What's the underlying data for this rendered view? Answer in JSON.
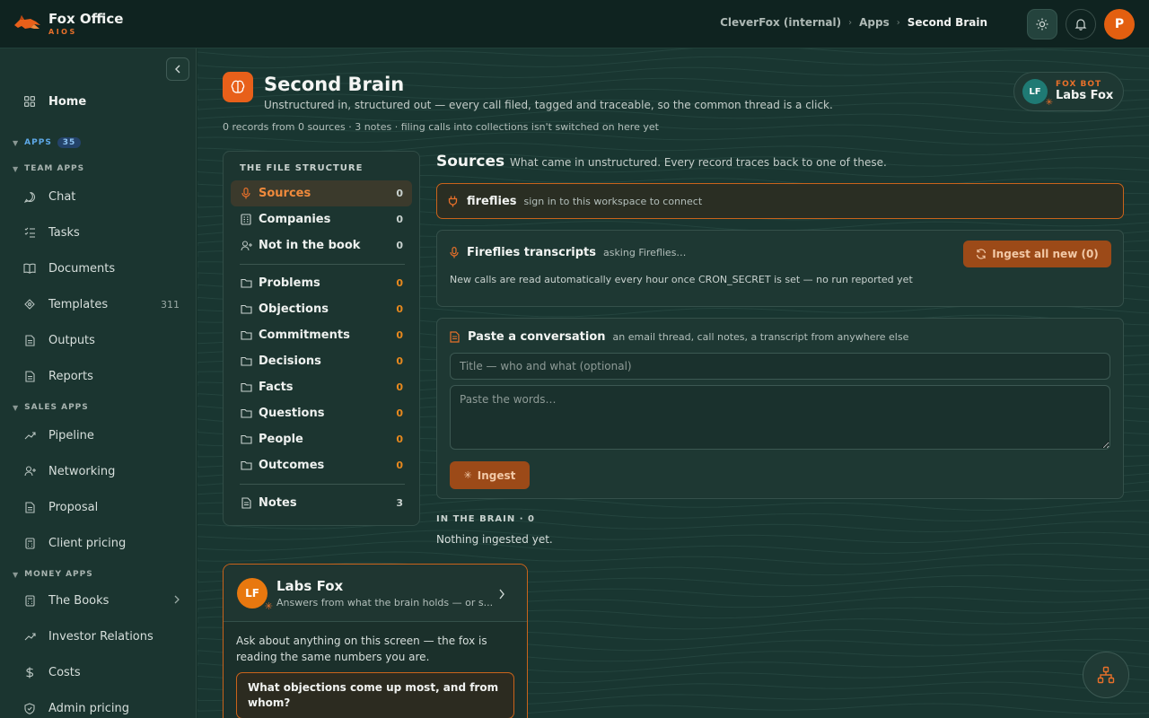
{
  "brand": {
    "name": "Fox Office",
    "sub": "AIOS"
  },
  "breadcrumb": [
    "CleverFox (internal)",
    "Apps",
    "Second Brain"
  ],
  "user_initial": "P",
  "sidebar": {
    "home": "Home",
    "apps_label": "APPS",
    "apps_count": "35",
    "team_label": "TEAM APPS",
    "team_items": [
      {
        "label": "Chat",
        "icon": "chat-icon"
      },
      {
        "label": "Tasks",
        "icon": "tasks-icon"
      },
      {
        "label": "Documents",
        "icon": "book-icon"
      },
      {
        "label": "Templates",
        "icon": "diamond-icon",
        "count": "311"
      },
      {
        "label": "Outputs",
        "icon": "file-icon"
      },
      {
        "label": "Reports",
        "icon": "file-icon"
      }
    ],
    "sales_label": "SALES APPS",
    "sales_items": [
      {
        "label": "Pipeline",
        "icon": "trend-icon"
      },
      {
        "label": "Networking",
        "icon": "user-plus-icon"
      },
      {
        "label": "Proposal",
        "icon": "file-icon"
      },
      {
        "label": "Client pricing",
        "icon": "calculator-icon"
      }
    ],
    "money_label": "MONEY APPS",
    "money_items": [
      {
        "label": "The Books",
        "icon": "calculator-icon"
      },
      {
        "label": "Investor Relations",
        "icon": "trend-icon"
      },
      {
        "label": "Costs",
        "icon": "dollar-icon"
      },
      {
        "label": "Admin pricing",
        "icon": "shield-icon"
      }
    ]
  },
  "page": {
    "title": "Second Brain",
    "subtitle": "Unstructured in, structured out — every call filed, tagged and traceable, so the common thread is a click.",
    "stats": "0 records from 0 sources · 3 notes · filing calls into collections isn't switched on here yet"
  },
  "foxbot": {
    "initials": "LF",
    "label": "FOX BOT",
    "name": "Labs Fox"
  },
  "file_structure": {
    "title": "THE FILE STRUCTURE",
    "top": [
      {
        "label": "Sources",
        "count": "0",
        "icon": "mic-icon"
      },
      {
        "label": "Companies",
        "count": "0",
        "icon": "building-icon"
      },
      {
        "label": "Not in the book",
        "count": "0",
        "icon": "user-plus-icon"
      }
    ],
    "collections": [
      {
        "label": "Problems",
        "count": "0"
      },
      {
        "label": "Objections",
        "count": "0"
      },
      {
        "label": "Commitments",
        "count": "0"
      },
      {
        "label": "Decisions",
        "count": "0"
      },
      {
        "label": "Facts",
        "count": "0"
      },
      {
        "label": "Questions",
        "count": "0"
      },
      {
        "label": "People",
        "count": "0"
      },
      {
        "label": "Outcomes",
        "count": "0"
      }
    ],
    "notes": {
      "label": "Notes",
      "count": "3"
    }
  },
  "sources": {
    "title": "Sources",
    "subtitle": "What came in unstructured. Every record traces back to one of these.",
    "fireflies": {
      "name": "fireflies",
      "hint": "sign in to this workspace to connect"
    },
    "transcripts": {
      "title": "Fireflies transcripts",
      "hint": "asking Fireflies…",
      "button": "Ingest all new (0)",
      "note": "New calls are read automatically every hour once CRON_SECRET is set — no run reported yet"
    },
    "paste": {
      "title": "Paste a conversation",
      "hint": "an email thread, call notes, a transcript from anywhere else",
      "title_placeholder": "Title — who and what (optional)",
      "words_placeholder": "Paste the words…",
      "button": "Ingest"
    }
  },
  "brain": {
    "heading": "IN THE BRAIN · 0",
    "empty": "Nothing ingested yet."
  },
  "labs_fox": {
    "initials": "LF",
    "name": "Labs Fox",
    "subtitle": "Answers from what the brain holds — or s...",
    "intro": "Ask about anything on this screen — the fox is reading the same numbers you are.",
    "prompt": "What objections come up most, and from whom?"
  },
  "colors": {
    "accent": "#e8601a",
    "bg": "#193631",
    "topbar": "#0f2320"
  }
}
